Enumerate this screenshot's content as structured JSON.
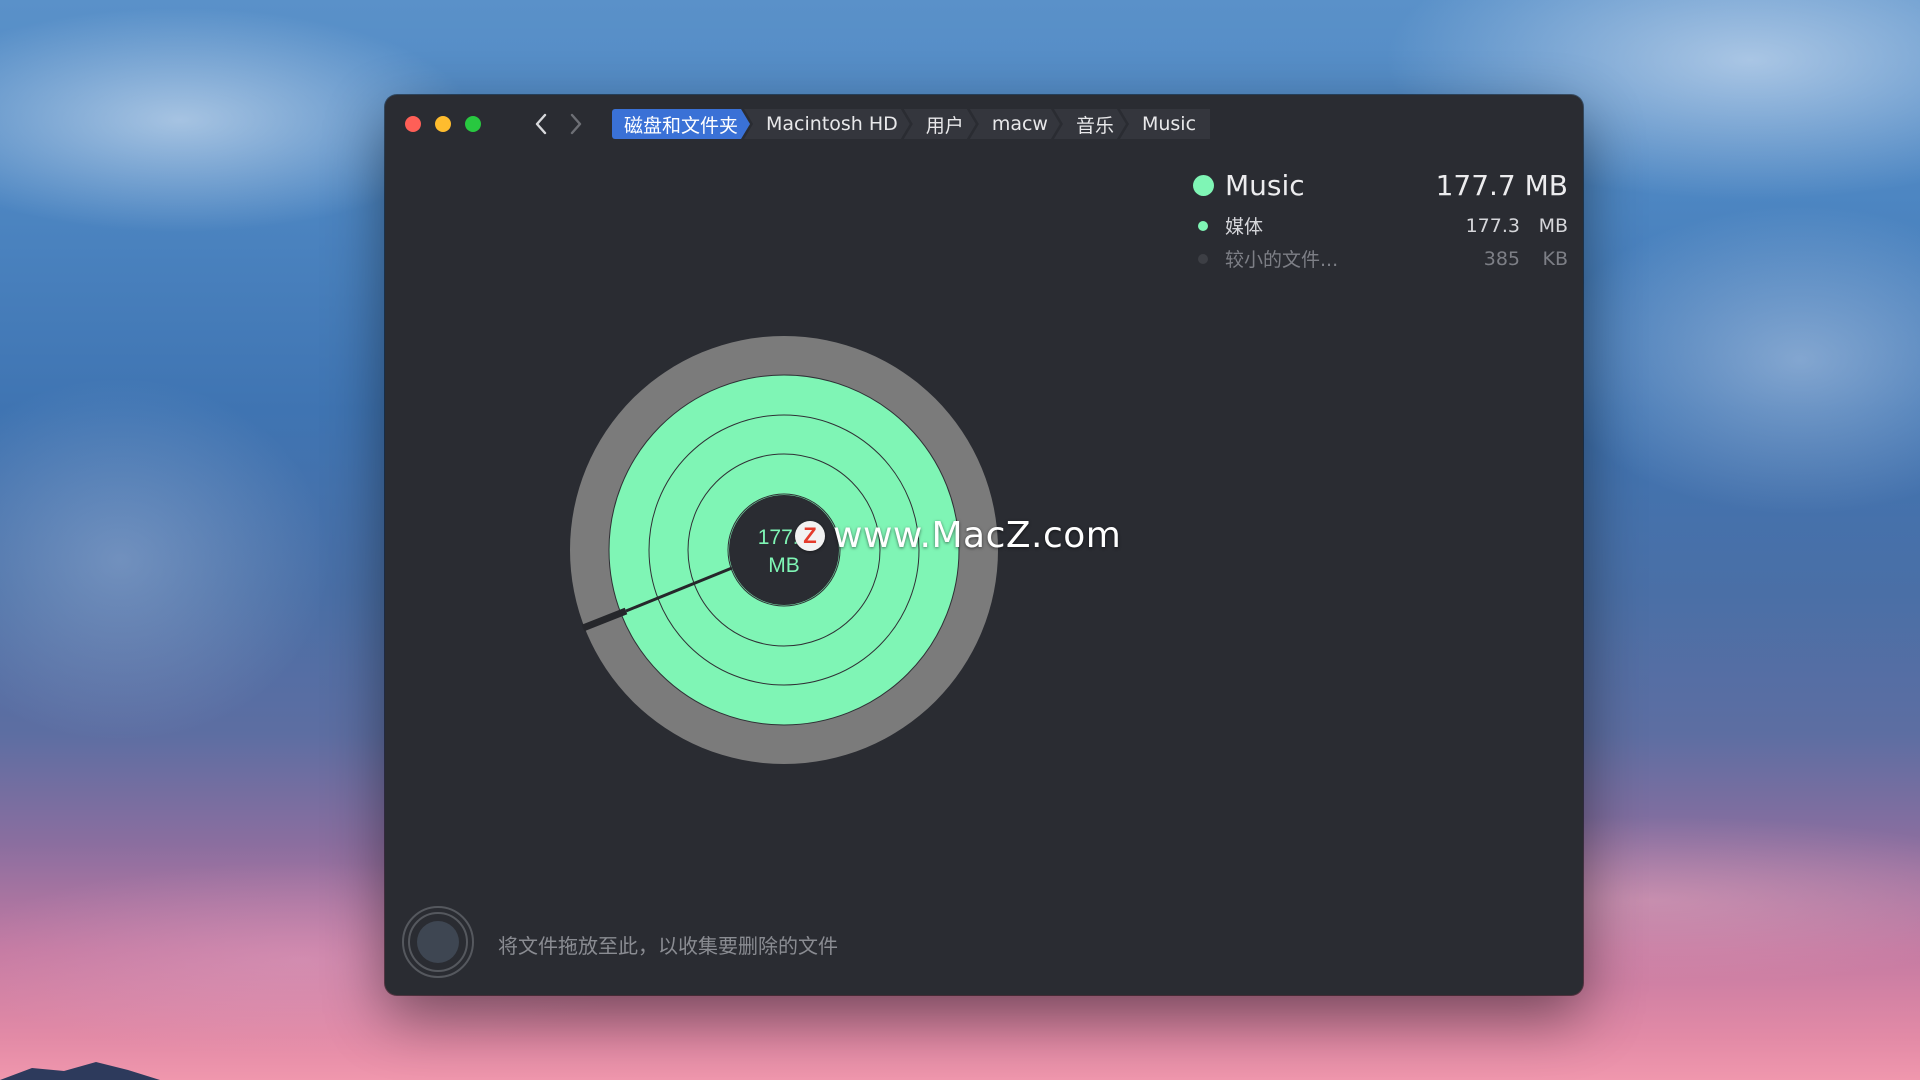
{
  "window": {
    "traffic_lights": [
      "close",
      "minimize",
      "zoom"
    ]
  },
  "nav": {
    "back_icon": "chevron-left-icon",
    "forward_icon": "chevron-right-icon"
  },
  "breadcrumb": {
    "items": [
      "磁盘和文件夹",
      "Macintosh HD",
      "用户",
      "macw",
      "音乐",
      "Music"
    ]
  },
  "legend": {
    "main": {
      "name": "Music",
      "size": "177.7 MB",
      "color": "#7ff5b5"
    },
    "items": [
      {
        "label": "媒体",
        "value": "177.3",
        "unit": "MB",
        "color": "#7ff5b5"
      },
      {
        "label": "较小的文件...",
        "value": "385",
        "unit": "KB",
        "color": "#3d3f45"
      }
    ]
  },
  "chart": {
    "center_value": "177.7",
    "center_unit": "MB",
    "colors": {
      "media": "#7ff5b5",
      "outer": "#7b7b7b",
      "center": "#2a2c32"
    }
  },
  "watermark": {
    "badge": "Z",
    "text": "www.MacZ.com"
  },
  "dropzone": {
    "hint": "将文件拖放至此，以收集要删除的文件"
  }
}
